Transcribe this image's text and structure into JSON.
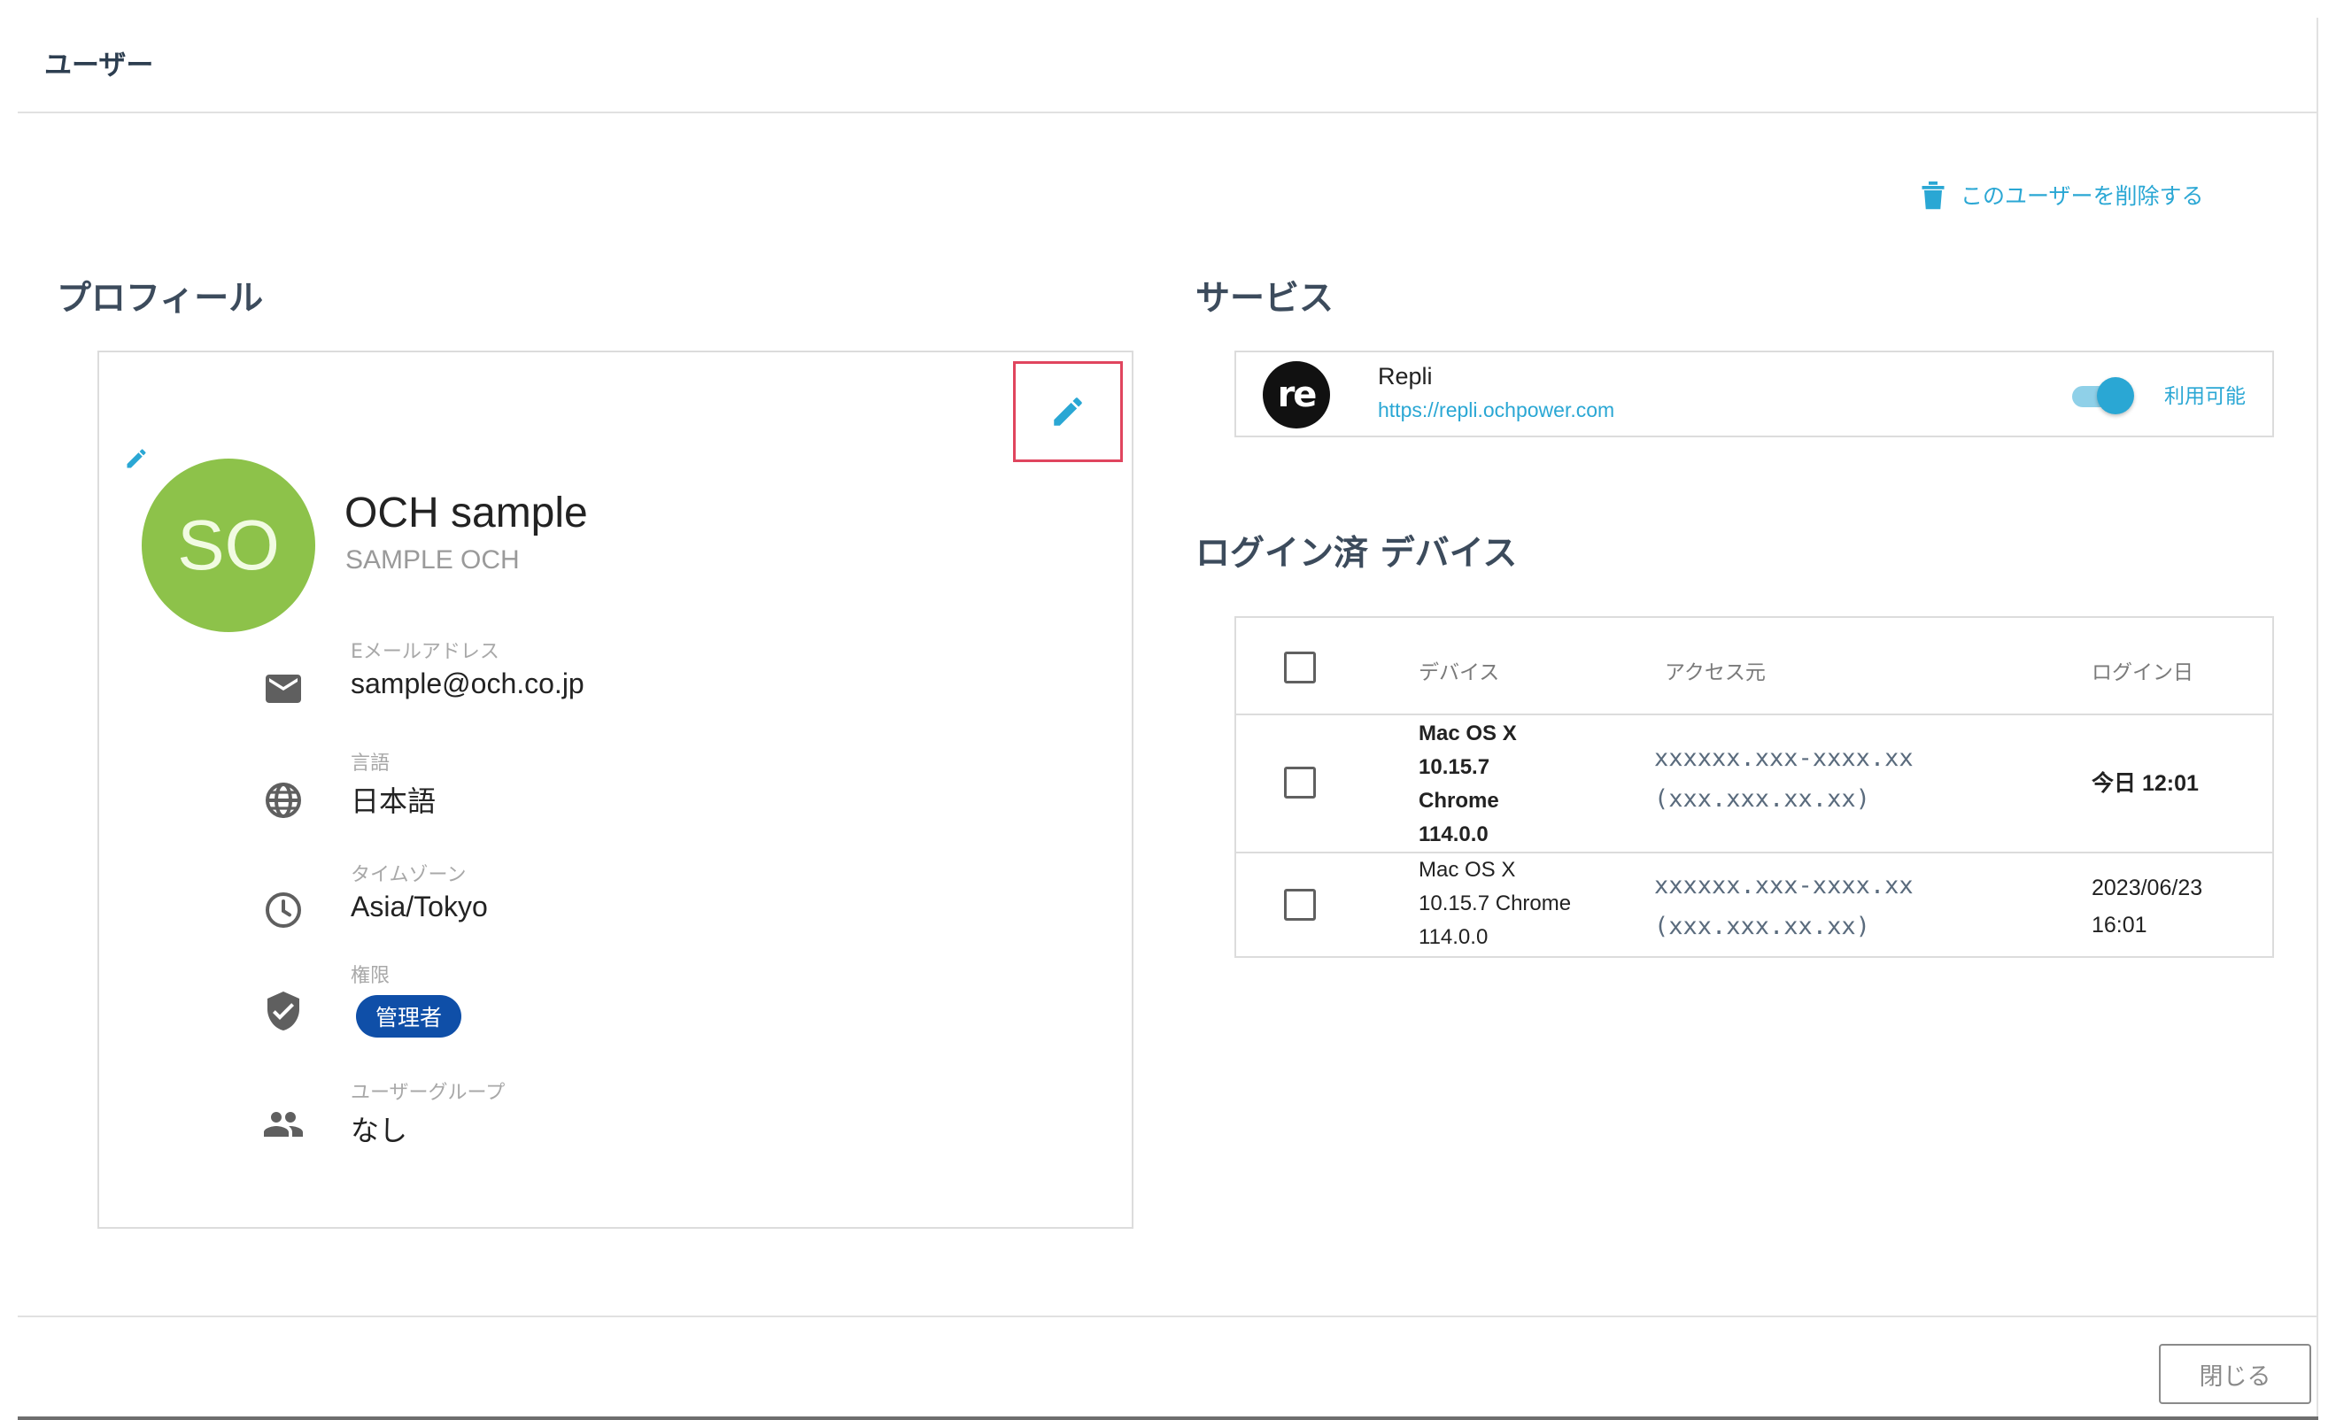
{
  "dialog": {
    "title": "ユーザー",
    "delete_label": "このユーザーを削除する",
    "close_label": "閉じる"
  },
  "profile": {
    "heading": "プロフィール",
    "avatar_initials": "SO",
    "avatar_color": "#8dc24a",
    "name": "OCH sample",
    "name_kana": "SAMPLE OCH",
    "fields": [
      {
        "icon": "mail-icon",
        "label": "Eメールアドレス",
        "value": "sample@och.co.jp"
      },
      {
        "icon": "globe-icon",
        "label": "言語",
        "value": "日本語"
      },
      {
        "icon": "clock-icon",
        "label": "タイムゾーン",
        "value": "Asia/Tokyo"
      },
      {
        "icon": "shield-check-icon",
        "label": "権限",
        "value": "管理者"
      },
      {
        "icon": "people-icon",
        "label": "ユーザーグループ",
        "value": "なし"
      }
    ]
  },
  "services": {
    "heading": "サービス",
    "items": [
      {
        "logo_text": "re",
        "name": "Repli",
        "url": "https://repli.ochpower.com",
        "enabled": true,
        "status": "利用可能"
      }
    ]
  },
  "devices": {
    "heading": "ログイン済 デバイス",
    "columns": [
      "デバイス",
      "アクセス元",
      "ログイン日"
    ],
    "rows": [
      {
        "device_lines": [
          "Mac OS X",
          "10.15.7",
          "Chrome",
          "114.0.0"
        ],
        "source_lines": [
          "xxxxxx.xxx-xxxx.xx",
          "(xxx.xxx.xx.xx)"
        ],
        "login": "今日 12:01",
        "current": true
      },
      {
        "device_lines": [
          "Mac OS X",
          "10.15.7 Chrome",
          "114.0.0"
        ],
        "source_lines": [
          "xxxxxx.xxx-xxxx.xx",
          "(xxx.xxx.xx.xx)"
        ],
        "login_lines": [
          "2023/06/23",
          "16:01"
        ],
        "current": false
      }
    ]
  },
  "colors": {
    "accent": "#2aa7d4",
    "heading": "#3c4b5c",
    "badge": "#0f4fa8",
    "highlight_box": "#e0455e"
  }
}
